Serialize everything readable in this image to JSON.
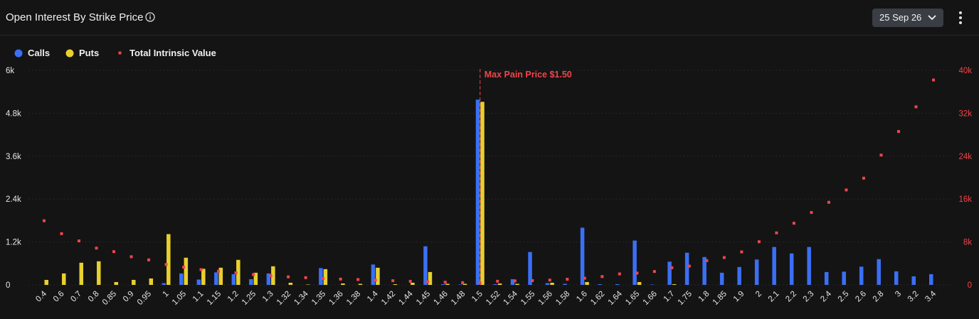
{
  "header": {
    "title": "Open Interest By Strike Price",
    "info_icon": "info-icon",
    "date_value": "25 Sep 26",
    "date_icon": "chevron-down-icon",
    "menu_icon": "kebab-menu-icon"
  },
  "legend": {
    "items": [
      {
        "label": "Calls",
        "color": "#3b6ff5"
      },
      {
        "label": "Puts",
        "color": "#e8d02e"
      },
      {
        "label": "Total Intrinsic Value",
        "color": "#f0454b"
      }
    ]
  },
  "chart_data": {
    "type": "bar",
    "categories": [
      "0.4",
      "0.6",
      "0.7",
      "0.8",
      "0.85",
      "0.9",
      "0.95",
      "1",
      "1.05",
      "1.1",
      "1.15",
      "1.2",
      "1.25",
      "1.3",
      "1.32",
      "1.34",
      "1.35",
      "1.36",
      "1.38",
      "1.4",
      "1.42",
      "1.44",
      "1.45",
      "1.46",
      "1.48",
      "1.5",
      "1.52",
      "1.54",
      "1.55",
      "1.56",
      "1.58",
      "1.6",
      "1.62",
      "1.64",
      "1.65",
      "1.66",
      "1.7",
      "1.75",
      "1.8",
      "1.85",
      "1.9",
      "2",
      "2.1",
      "2.2",
      "2.3",
      "2.4",
      "2.5",
      "2.6",
      "2.8",
      "3",
      "3.2",
      "3.4"
    ],
    "series": [
      {
        "name": "Calls",
        "color": "#3b6ff5",
        "axis": "left",
        "values": [
          0,
          0,
          0,
          0,
          0,
          0,
          0,
          50,
          320,
          150,
          350,
          300,
          160,
          320,
          0,
          0,
          470,
          0,
          0,
          570,
          0,
          0,
          1080,
          20,
          10,
          5180,
          20,
          160,
          920,
          50,
          30,
          1600,
          20,
          20,
          1240,
          10,
          650,
          900,
          780,
          340,
          500,
          710,
          1060,
          880,
          1060,
          360,
          370,
          510,
          720,
          380,
          240,
          300
        ]
      },
      {
        "name": "Puts",
        "color": "#e8d02e",
        "axis": "left",
        "values": [
          140,
          320,
          620,
          660,
          80,
          140,
          180,
          1420,
          760,
          450,
          480,
          700,
          340,
          520,
          60,
          10,
          440,
          40,
          30,
          480,
          20,
          60,
          360,
          30,
          30,
          5120,
          40,
          30,
          0,
          60,
          0,
          80,
          0,
          0,
          80,
          0,
          20,
          0,
          0,
          0,
          0,
          0,
          0,
          0,
          0,
          0,
          0,
          0,
          0,
          0,
          0,
          0
        ]
      },
      {
        "name": "Total Intrinsic Value",
        "color": "#f0454b",
        "axis": "right",
        "kind": "scatter",
        "values": [
          11960,
          9550,
          8200,
          6860,
          6200,
          5250,
          4660,
          3800,
          3300,
          2850,
          2540,
          2250,
          1930,
          1700,
          1500,
          1350,
          1200,
          1080,
          1000,
          880,
          780,
          670,
          580,
          500,
          420,
          350,
          680,
          750,
          800,
          900,
          1050,
          1250,
          1550,
          2050,
          2200,
          2500,
          3200,
          3500,
          4520,
          5100,
          6150,
          8050,
          9700,
          11500,
          13500,
          15400,
          17700,
          19900,
          24200,
          28600,
          33200,
          38200
        ]
      }
    ],
    "y_left": {
      "ticks": [
        "0",
        "1.2k",
        "2.4k",
        "3.6k",
        "4.8k",
        "6k"
      ],
      "min": 0,
      "max": 6000
    },
    "y_right": {
      "ticks": [
        "0",
        "8k",
        "16k",
        "24k",
        "32k",
        "40k"
      ],
      "min": 0,
      "max": 40000
    },
    "annotation": {
      "text": "Max Pain Price $1.50",
      "category": "1.5"
    },
    "grid": true,
    "legend_position": "top-left"
  }
}
